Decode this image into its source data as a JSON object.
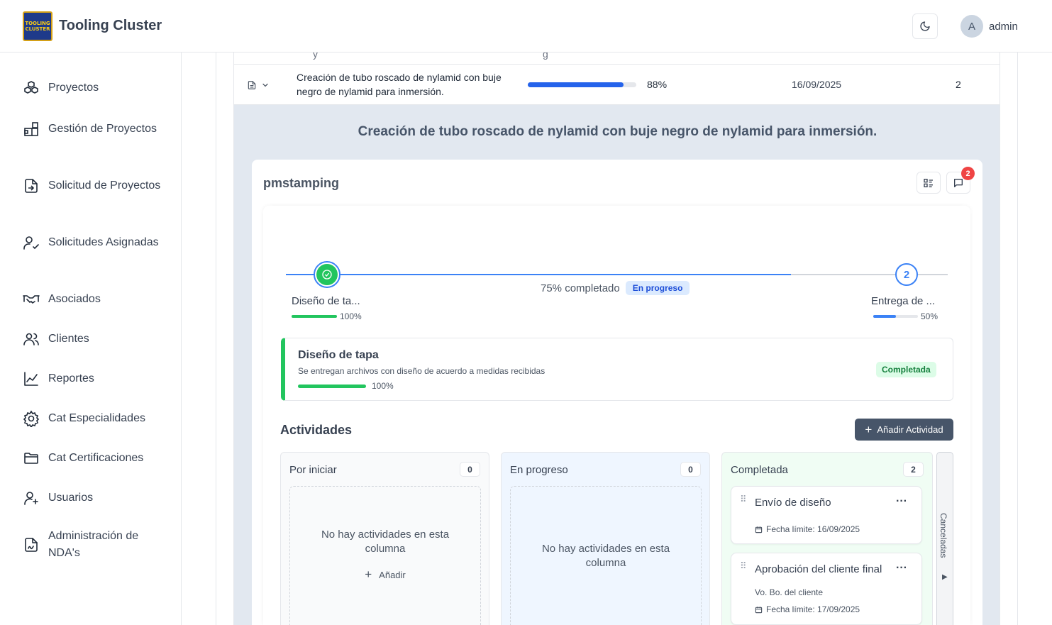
{
  "app": {
    "title": "Tooling Cluster",
    "logo_text": [
      "TOOLING",
      "CLUSTER"
    ],
    "user": {
      "initial": "A",
      "name": "admin"
    }
  },
  "sidebar": {
    "items": [
      {
        "label": "Proyectos",
        "icon": "cubes-icon"
      },
      {
        "label": "Gestión de Proyectos",
        "icon": "grid-plus-icon"
      },
      {
        "label": "Solicitud de Proyectos",
        "icon": "file-import-icon"
      },
      {
        "label": "Solicitudes Asignadas",
        "icon": "user-check-icon"
      },
      {
        "label": "Asociados",
        "icon": "handshake-icon"
      },
      {
        "label": "Clientes",
        "icon": "users-icon"
      },
      {
        "label": "Reportes",
        "icon": "line-chart-icon"
      },
      {
        "label": "Cat Especialidades",
        "icon": "gear-icon"
      },
      {
        "label": "Cat Certificaciones",
        "icon": "folder-icon"
      },
      {
        "label": "Usuarios",
        "icon": "user-plus-icon"
      },
      {
        "label": "Administración de NDA's",
        "icon": "file-signature-icon"
      }
    ]
  },
  "project_row": {
    "name": "Creación de tubo roscado de nylamid con buje negro de nylamid para inmersión.",
    "progress": 88,
    "progress_label": "88%",
    "date": "16/09/2025",
    "count": "2"
  },
  "detail": {
    "title": "Creación de tubo roscado de nylamid con buje negro de nylamid para inmersión.",
    "company": "pmstamping",
    "notifications": "2",
    "overall_label": "75% completado",
    "overall_progress": 75,
    "status": "En progreso",
    "steps": [
      {
        "label": "Diseño de ta...",
        "progress": 100,
        "progress_label": "100%",
        "marker": "check"
      },
      {
        "label": "Entrega de ...",
        "progress": 50,
        "progress_label": "50%",
        "marker": "2"
      }
    ],
    "phase": {
      "title": "Diseño de tapa",
      "description": "Se entregan archivos con diseño de acuerdo a medidas recibidas",
      "progress": 100,
      "progress_label": "100%",
      "status": "Completada"
    }
  },
  "activities": {
    "title": "Actividades",
    "add_button": "Añadir Actividad",
    "columns": [
      {
        "title": "Por iniciar",
        "count": "0",
        "empty_text": "No hay actividades en esta columna",
        "add_label": "Añadir"
      },
      {
        "title": "En progreso",
        "count": "0",
        "empty_text": "No hay actividades en esta columna"
      },
      {
        "title": "Completada",
        "count": "2",
        "cards": [
          {
            "title": "Envío de diseño",
            "due": "Fecha límite: 16/09/2025"
          },
          {
            "title": "Aprobación del cliente final",
            "subtitle": "Vo. Bo. del cliente",
            "due": "Fecha límite: 17/09/2025"
          }
        ]
      }
    ],
    "collapsed_column": "Canceladas"
  },
  "colors": {
    "primary": "#2563eb",
    "success": "#22c55e",
    "slate": "#475569",
    "danger": "#ef4444"
  }
}
